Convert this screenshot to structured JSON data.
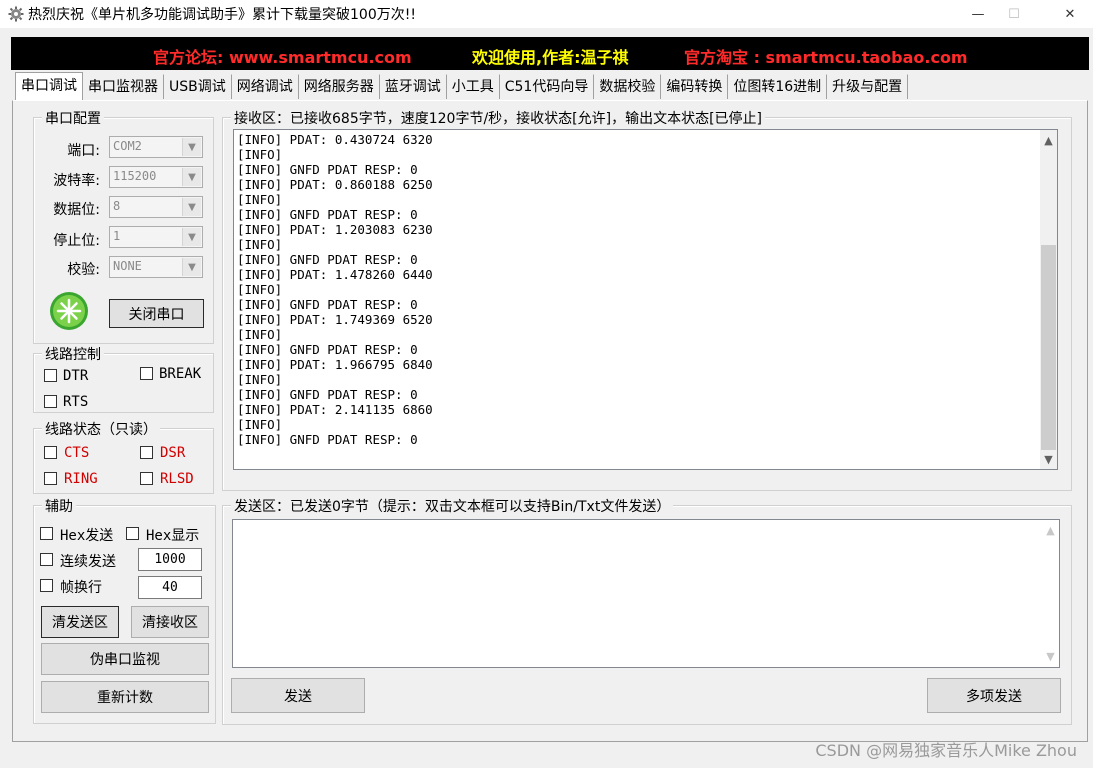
{
  "window": {
    "title": "热烈庆祝《单片机多功能调试助手》累计下载量突破100万次!!",
    "minimize_glyph": "—",
    "maximize_glyph": "☐",
    "close_glyph": "✕"
  },
  "banner": {
    "forum": "官方论坛: www.smartmcu.com",
    "welcome": "欢迎使用,作者:温子祺",
    "shop": "官方淘宝 : smartmcu.taobao.com",
    "colors": {
      "forum": "#ff2a2a",
      "welcome": "#ffff00",
      "shop": "#ff2a2a",
      "background": "#000000"
    }
  },
  "tabs": [
    "串口调试",
    "串口监视器",
    "USB调试",
    "网络调试",
    "网络服务器",
    "蓝牙调试",
    "小工具",
    "C51代码向导",
    "数据校验",
    "编码转换",
    "位图转16进制",
    "升级与配置"
  ],
  "serial_config": {
    "title": "串口配置",
    "port_label": "端口:",
    "port_value": "COM2",
    "baud_label": "波特率:",
    "baud_value": "115200",
    "databits_label": "数据位:",
    "databits_value": "8",
    "stopbits_label": "停止位:",
    "stopbits_value": "1",
    "parity_label": "校验:",
    "parity_value": "NONE",
    "close_button": "关闭串口",
    "status_icon": "green-led-icon"
  },
  "line_control": {
    "title": "线路控制",
    "dtr": "DTR",
    "break": "BREAK",
    "rts": "RTS"
  },
  "line_status": {
    "title": "线路状态（只读）",
    "cts": "CTS",
    "dsr": "DSR",
    "ring": "RING",
    "rlsd": "RLSD",
    "color": "#d00000"
  },
  "aux": {
    "title": "辅助",
    "hex_send": "Hex发送",
    "hex_show": "Hex显示",
    "continuous_send": "连续发送",
    "interval_value": "1000",
    "frame_newline": "帧换行",
    "frame_value": "40",
    "clear_send": "清发送区",
    "clear_recv": "清接收区",
    "pseudo_monitor": "伪串口监视",
    "recount": "重新计数"
  },
  "receive": {
    "title": "接收区：已接收685字节，速度120字节/秒，接收状态[允许]，输出文本状态[已停止]",
    "lines": [
      "[INFO] PDAT: 0.430724 6320",
      "[INFO]",
      "[INFO] GNFD PDAT RESP: 0",
      "[INFO] PDAT: 0.860188 6250",
      "[INFO]",
      "[INFO] GNFD PDAT RESP: 0",
      "[INFO] PDAT: 1.203083 6230",
      "[INFO]",
      "[INFO] GNFD PDAT RESP: 0",
      "[INFO] PDAT: 1.478260 6440",
      "[INFO]",
      "[INFO] GNFD PDAT RESP: 0",
      "[INFO] PDAT: 1.749369 6520",
      "[INFO]",
      "[INFO] GNFD PDAT RESP: 0",
      "[INFO] PDAT: 1.966795 6840",
      "[INFO]",
      "[INFO] GNFD PDAT RESP: 0",
      "[INFO] PDAT: 2.141135 6860",
      "[INFO]",
      "[INFO] GNFD PDAT RESP: 0"
    ]
  },
  "send": {
    "title": "发送区：已发送0字节（提示：双击文本框可以支持Bin/Txt文件发送）",
    "send_button": "发送",
    "multi_send_button": "多项发送"
  },
  "watermark": "CSDN @网易独家音乐人Mike Zhou"
}
